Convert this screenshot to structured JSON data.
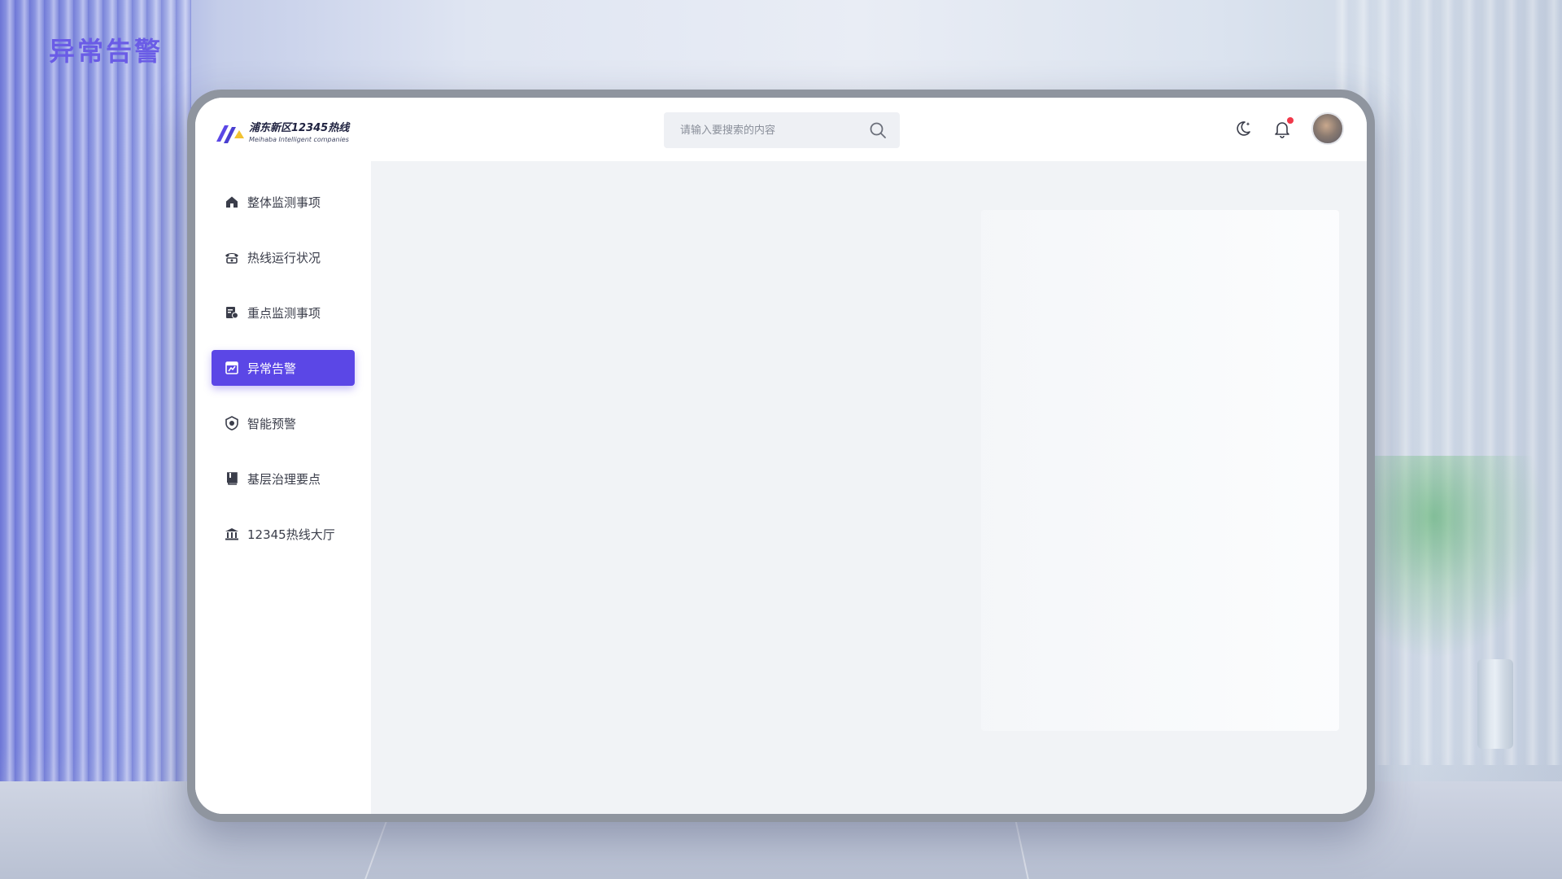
{
  "page_heading": "异常告警",
  "app": {
    "title": "浦东新区12345热线",
    "subtitle": "Meihaba Intelligent companies"
  },
  "search": {
    "placeholder": "请输入要搜索的内容",
    "value": ""
  },
  "notifications": {
    "has_unread": true
  },
  "sidebar": {
    "items": [
      {
        "label": "整体监测事项",
        "icon": "home-icon",
        "active": false
      },
      {
        "label": "热线运行状况",
        "icon": "phone-icon",
        "active": false
      },
      {
        "label": "重点监测事项",
        "icon": "document-chart-icon",
        "active": false
      },
      {
        "label": "异常告警",
        "icon": "alert-report-icon",
        "active": true
      },
      {
        "label": "智能预警",
        "icon": "shield-eye-icon",
        "active": false
      },
      {
        "label": "基层治理要点",
        "icon": "book-icon",
        "active": false
      },
      {
        "label": "12345热线大厅",
        "icon": "bank-icon",
        "active": false
      }
    ]
  },
  "colors": {
    "accent": "#5b47e6",
    "heading": "#6a5ce6",
    "badge": "#f0384a"
  }
}
